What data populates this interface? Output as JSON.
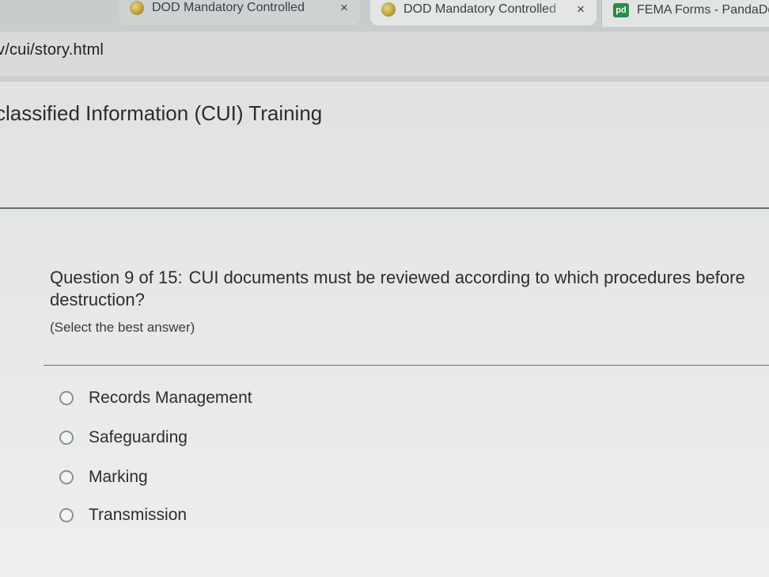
{
  "browser": {
    "tabs": [
      {
        "title": "DOD Mandatory Controlled",
        "close": "×"
      },
      {
        "title": "DOD Mandatory Controlled",
        "close": "×"
      },
      {
        "title": "FEMA Forms - PandaDoc",
        "icon_text": "pd"
      }
    ],
    "url": "v/cui/story.html"
  },
  "page": {
    "course_title": "classified Information (CUI) Training",
    "question": {
      "number": "Question 9 of 15:",
      "text": "CUI documents must be reviewed according to which procedures before destruction?",
      "instruction": "(Select the best answer)"
    },
    "options": [
      {
        "label": "Records Management",
        "selected": false
      },
      {
        "label": "Safeguarding",
        "selected": false
      },
      {
        "label": "Marking",
        "selected": false
      },
      {
        "label": "Transmission",
        "selected": false
      }
    ]
  },
  "colors": {
    "accent_pandadoc": "#2b8a4a",
    "text": "#2b2d2f",
    "rule": "#6a6d6f"
  }
}
